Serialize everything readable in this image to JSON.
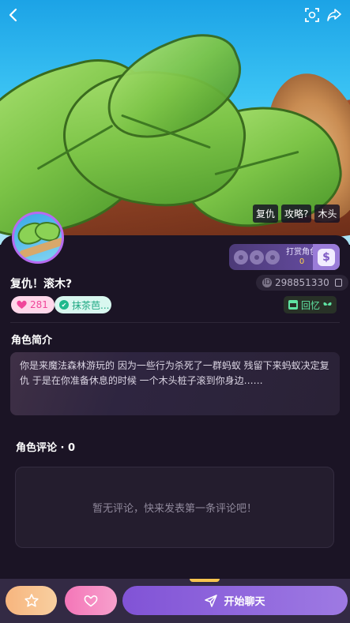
{
  "header": {
    "back_icon": "chevron-left-icon",
    "scan_icon": "scan-icon",
    "share_icon": "share-icon"
  },
  "hero": {
    "tags": [
      "复仇",
      "攻略?",
      "木头"
    ]
  },
  "character": {
    "name": "复仇！滚木?",
    "id": "298851330",
    "likes": "281",
    "tea_tag": "抹茶芭...",
    "memory_label": "回忆"
  },
  "reward": {
    "label": "打赏角色",
    "count": "0",
    "icon": "money-bag-icon"
  },
  "intro": {
    "title": "角色简介",
    "text": "你是来魔法森林游玩的 因为一些行为杀死了一群蚂蚁 残留下来蚂蚁决定复仇 于是在你准备休息的时候 一个木头桩子滚到你身边……"
  },
  "comments": {
    "title": "角色评论 · ",
    "count": "0",
    "empty_text": "暂无评论，快来发表第一条评论吧！"
  },
  "bottom": {
    "chat_label": "开始聊天"
  },
  "colors": {
    "accent": "#8153d6",
    "pink": "#f476b8",
    "mint": "#5fe3a3",
    "gold": "#ffd24a"
  }
}
